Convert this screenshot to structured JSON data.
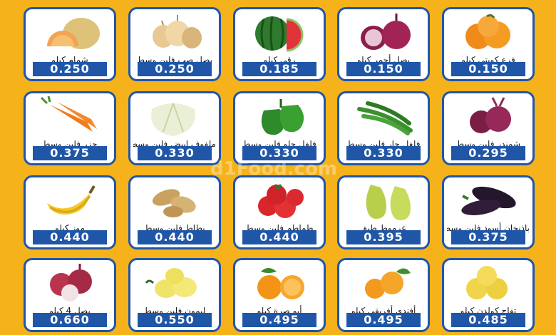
{
  "watermark": "d1Food.com",
  "products": [
    {
      "name": "فرع كويتي كيلو",
      "price": "0.150",
      "icon": "tangerine-icon"
    },
    {
      "name": "بصل أحمر كيلو",
      "price": "0.150",
      "icon": "red-onion-icon"
    },
    {
      "name": "رقي كيلو",
      "price": "0.185",
      "icon": "watermelon-icon"
    },
    {
      "name": "بصل صب فلين وسط",
      "price": "0.250",
      "icon": "onion-basket-icon"
    },
    {
      "name": "شمام كيلو",
      "price": "0.250",
      "icon": "melon-icon"
    },
    {
      "name": "شمندر فلين وسط",
      "price": "0.295",
      "icon": "beetroot-icon"
    },
    {
      "name": "فلفل حار فلين وسط",
      "price": "0.330",
      "icon": "green-chili-icon"
    },
    {
      "name": "فلفل حلو فلين وسط",
      "price": "0.330",
      "icon": "green-pepper-icon"
    },
    {
      "name": "ملفوف ابيض فلين وسط",
      "price": "0.330",
      "icon": "cabbage-icon"
    },
    {
      "name": "جزر فلين وسط",
      "price": "0.375",
      "icon": "carrot-icon"
    },
    {
      "name": "باذنجان أسود فلين وسط",
      "price": "0.375",
      "icon": "eggplant-icon"
    },
    {
      "name": "عرموط طبق",
      "price": "0.395",
      "icon": "pear-icon"
    },
    {
      "name": "طماطم فلين وسط",
      "price": "0.440",
      "icon": "tomato-icon"
    },
    {
      "name": "بطاط فلين وسط",
      "price": "0.440",
      "icon": "potato-icon"
    },
    {
      "name": "موز كيلو",
      "price": "0.440",
      "icon": "banana-icon"
    },
    {
      "name": "تفاح كولدن كيلو",
      "price": "0.485",
      "icon": "yellow-apple-icon"
    },
    {
      "name": "أفندي أفريقي كيلو",
      "price": "0.495",
      "icon": "mandarin-icon"
    },
    {
      "name": "أبو صرة كيلو",
      "price": "0.495",
      "icon": "orange-icon"
    },
    {
      "name": "ليمون فلين وسط",
      "price": "0.550",
      "icon": "lemon-icon"
    },
    {
      "name": "بصل 4 كيلو",
      "price": "0.660",
      "icon": "onion-bag-icon"
    }
  ]
}
